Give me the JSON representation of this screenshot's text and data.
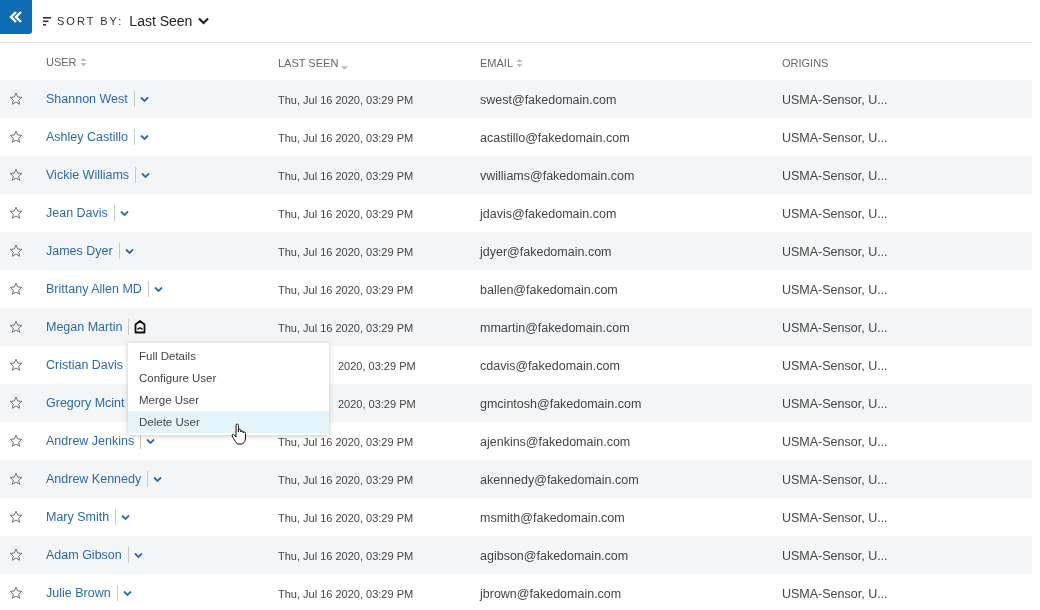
{
  "toolbar": {
    "sort_label": "SORT BY:",
    "sort_value": "Last Seen"
  },
  "table": {
    "columns": [
      {
        "label": "USER",
        "sort_up": true,
        "sort_down": true
      },
      {
        "label": "LAST SEEN",
        "sort_up": false,
        "sort_down": true
      },
      {
        "label": "EMAIL",
        "sort_up": true,
        "sort_down": true
      },
      {
        "label": "ORIGINS"
      }
    ],
    "rows": [
      {
        "starred": false,
        "name": "Shannon West",
        "last_seen": "Thu, Jul 16 2020, 03:29 PM",
        "email": "swest@fakedomain.com",
        "origins": "USMA-Sensor, U...",
        "menu_open": false,
        "covered": false
      },
      {
        "starred": false,
        "name": "Ashley Castillo",
        "last_seen": "Thu, Jul 16 2020, 03:29 PM",
        "email": "acastillo@fakedomain.com",
        "origins": "USMA-Sensor, U...",
        "menu_open": false,
        "covered": false
      },
      {
        "starred": false,
        "name": "Vickie Williams",
        "last_seen": "Thu, Jul 16 2020, 03:29 PM",
        "email": "vwilliams@fakedomain.com",
        "origins": "USMA-Sensor, U...",
        "menu_open": false,
        "covered": false
      },
      {
        "starred": false,
        "name": "Jean Davis",
        "last_seen": "Thu, Jul 16 2020, 03:29 PM",
        "email": "jdavis@fakedomain.com",
        "origins": "USMA-Sensor, U...",
        "menu_open": false,
        "covered": false
      },
      {
        "starred": false,
        "name": "James Dyer",
        "last_seen": "Thu, Jul 16 2020, 03:29 PM",
        "email": "jdyer@fakedomain.com",
        "origins": "USMA-Sensor, U...",
        "menu_open": false,
        "covered": false
      },
      {
        "starred": false,
        "name": "Brittany Allen MD",
        "last_seen": "Thu, Jul 16 2020, 03:29 PM",
        "email": "ballen@fakedomain.com",
        "origins": "USMA-Sensor, U...",
        "menu_open": false,
        "covered": false
      },
      {
        "starred": false,
        "name": "Megan Martin",
        "last_seen": "Thu, Jul 16 2020, 03:29 PM",
        "email": "mmartin@fakedomain.com",
        "origins": "USMA-Sensor, U...",
        "menu_open": true,
        "covered": false
      },
      {
        "starred": false,
        "name": "Cristian Davis",
        "last_seen": "2020, 03:29 PM",
        "email": "cdavis@fakedomain.com",
        "origins": "USMA-Sensor, U...",
        "menu_open": false,
        "covered": true
      },
      {
        "starred": false,
        "name": "Gregory Mcint",
        "last_seen": "2020, 03:29 PM",
        "email": "gmcintosh@fakedomain.com",
        "origins": "USMA-Sensor, U...",
        "menu_open": false,
        "covered": true
      },
      {
        "starred": false,
        "name": "Andrew Jenkins",
        "last_seen": "Thu, Jul 16 2020, 03:29 PM",
        "email": "ajenkins@fakedomain.com",
        "origins": "USMA-Sensor, U...",
        "menu_open": false,
        "covered": false
      },
      {
        "starred": false,
        "name": "Andrew Kennedy",
        "last_seen": "Thu, Jul 16 2020, 03:29 PM",
        "email": "akennedy@fakedomain.com",
        "origins": "USMA-Sensor, U...",
        "menu_open": false,
        "covered": false
      },
      {
        "starred": false,
        "name": "Mary Smith",
        "last_seen": "Thu, Jul 16 2020, 03:29 PM",
        "email": "msmith@fakedomain.com",
        "origins": "USMA-Sensor, U...",
        "menu_open": false,
        "covered": false
      },
      {
        "starred": false,
        "name": "Adam Gibson",
        "last_seen": "Thu, Jul 16 2020, 03:29 PM",
        "email": "agibson@fakedomain.com",
        "origins": "USMA-Sensor, U...",
        "menu_open": false,
        "covered": false
      },
      {
        "starred": false,
        "name": "Julie Brown",
        "last_seen": "Thu, Jul 16 2020, 03:29 PM",
        "email": "jbrown@fakedomain.com",
        "origins": "USMA-Sensor, U...",
        "menu_open": false,
        "covered": false
      }
    ]
  },
  "context_menu": {
    "items": [
      {
        "label": "Full Details",
        "selected": false
      },
      {
        "label": "Configure User",
        "selected": false
      },
      {
        "label": "Merge User",
        "selected": false
      },
      {
        "label": "Delete User",
        "selected": true
      }
    ]
  }
}
